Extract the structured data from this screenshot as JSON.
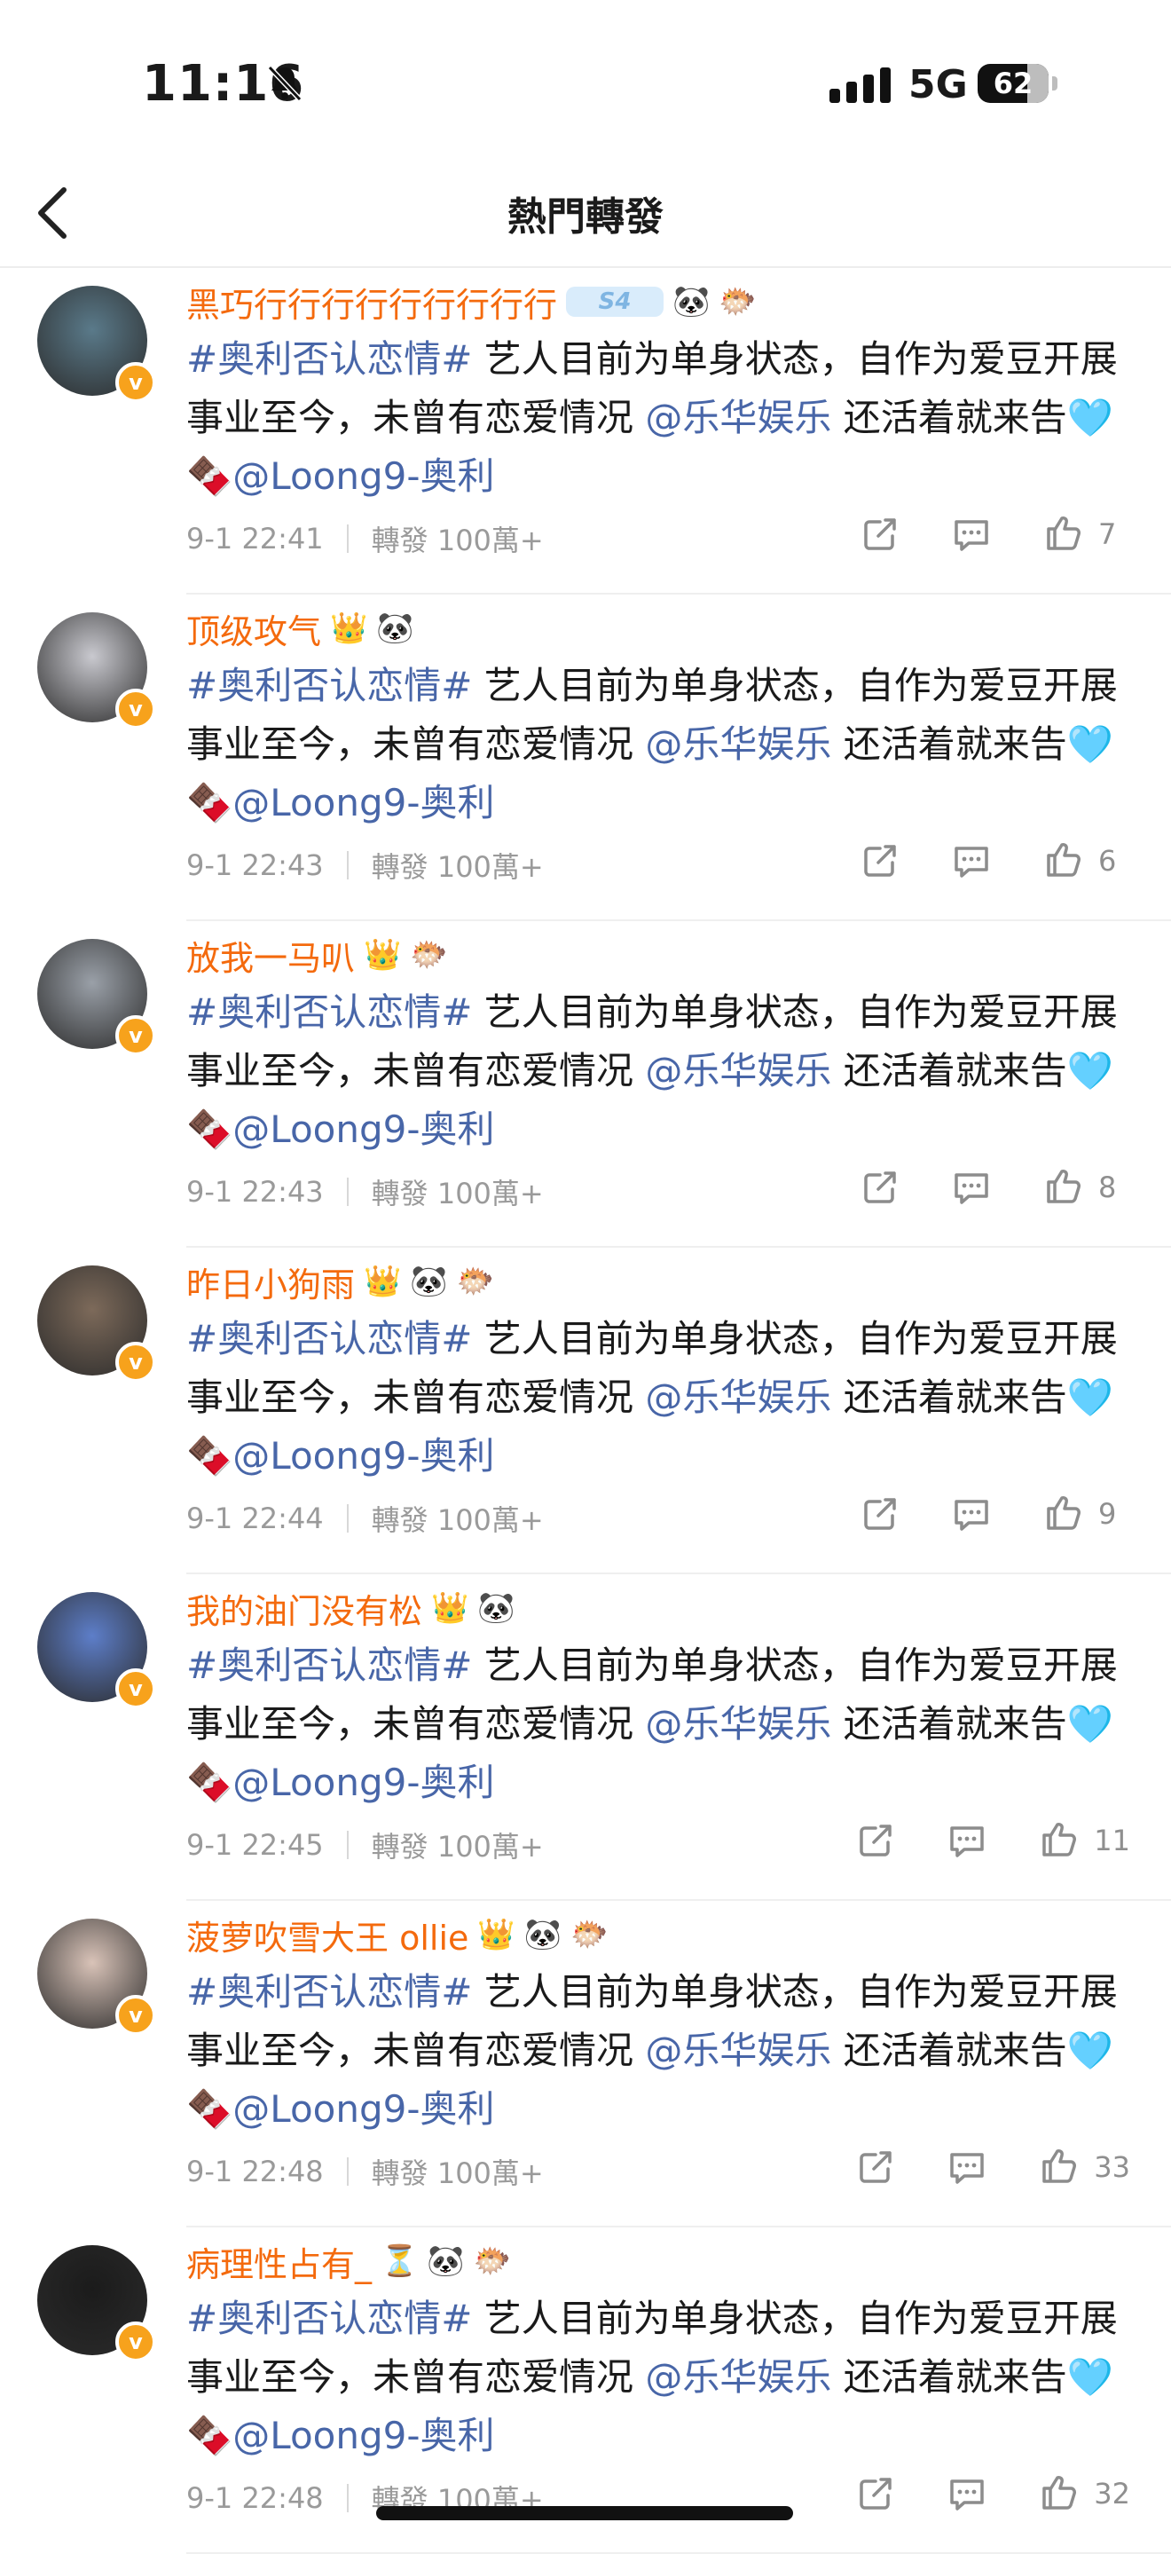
{
  "status_bar": {
    "time": "11:16",
    "network": "5G",
    "battery": "62"
  },
  "nav": {
    "title": "熱門轉發"
  },
  "hashtag": "#奥利否认恋情#",
  "text_a": "艺人目前为单身状态，自作为爱豆开展事业至今，未曾有恋爱情况",
  "mention1": "@乐华娱乐",
  "text_b": "还活着就来告",
  "mention2": "@Loong9-奥利",
  "repost_label": "轉發 100萬+",
  "emojis": {
    "heart": "🩵",
    "choco": "🍫",
    "panda": "🐼",
    "fish": "🐡",
    "crown": "👑",
    "hourglass": "⏳"
  },
  "items": [
    {
      "name": "黑巧行行行行行行行行行",
      "badge_s4": "S4",
      "time": "9-1 22:41",
      "likes": "7",
      "avatar_color": "#5a7a8a"
    },
    {
      "name": "顶级攻气",
      "time": "9-1 22:43",
      "likes": "6",
      "avatar_color": "#c9c9cf"
    },
    {
      "name": "放我一马叭",
      "time": "9-1 22:43",
      "likes": "8",
      "avatar_color": "#9aa0a8"
    },
    {
      "name": "昨日小狗雨",
      "time": "9-1 22:44",
      "likes": "9",
      "avatar_color": "#7d6a5a"
    },
    {
      "name": "我的油门没有松",
      "time": "9-1 22:45",
      "likes": "11",
      "avatar_color": "#5d7ec9"
    },
    {
      "name": "菠萝吹雪大王 ollie",
      "time": "9-1 22:48",
      "likes": "33",
      "avatar_color": "#d9c3b8"
    },
    {
      "name": "病理性占有_",
      "time": "9-1 22:48",
      "likes": "32",
      "avatar_color": "#1b1b1b"
    }
  ],
  "colors": {
    "username": "#f46a0d",
    "link": "#4866a8",
    "meta": "#9a9a9a",
    "verified": "#f7a21c"
  }
}
